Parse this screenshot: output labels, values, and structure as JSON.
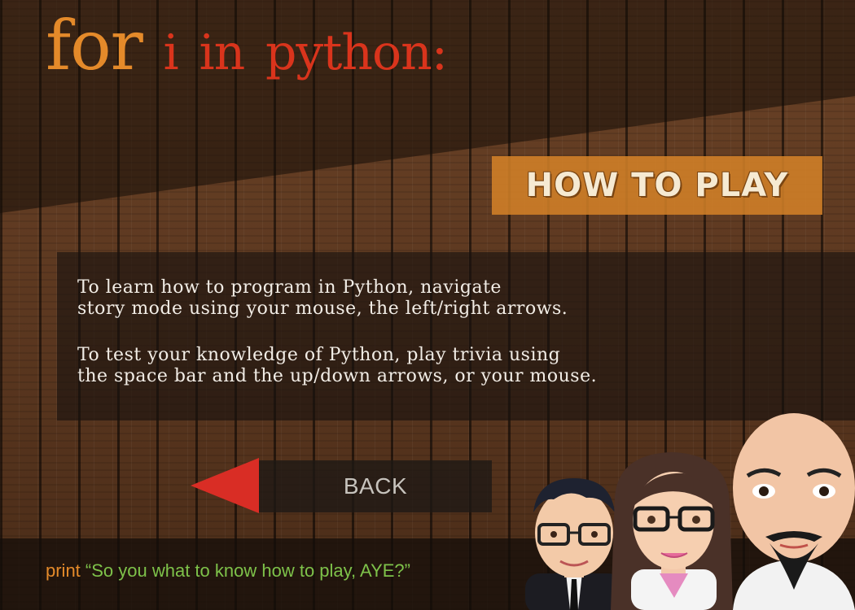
{
  "title": {
    "word1": "for",
    "word2": "i",
    "word3": "in",
    "word4": "python:"
  },
  "heading": "HOW TO PLAY",
  "instructions": {
    "para1_line1": "To learn how to program in Python, navigate",
    "para1_line2": "story mode using your mouse, the left/right arrows.",
    "para2_line1": "To test your knowledge of Python, play trivia using",
    "para2_line2": "the space bar and the up/down arrows, or your mouse."
  },
  "back_label": "BACK",
  "status": {
    "keyword": "print",
    "message": "“So you what to know how to play, AYE?”"
  },
  "colors": {
    "accent_orange": "#e48a2a",
    "accent_red": "#d9341c",
    "arrow_red": "#d92d25",
    "string_green": "#7ec24a"
  },
  "icons": {
    "back": "left-triangle-arrow-icon"
  }
}
